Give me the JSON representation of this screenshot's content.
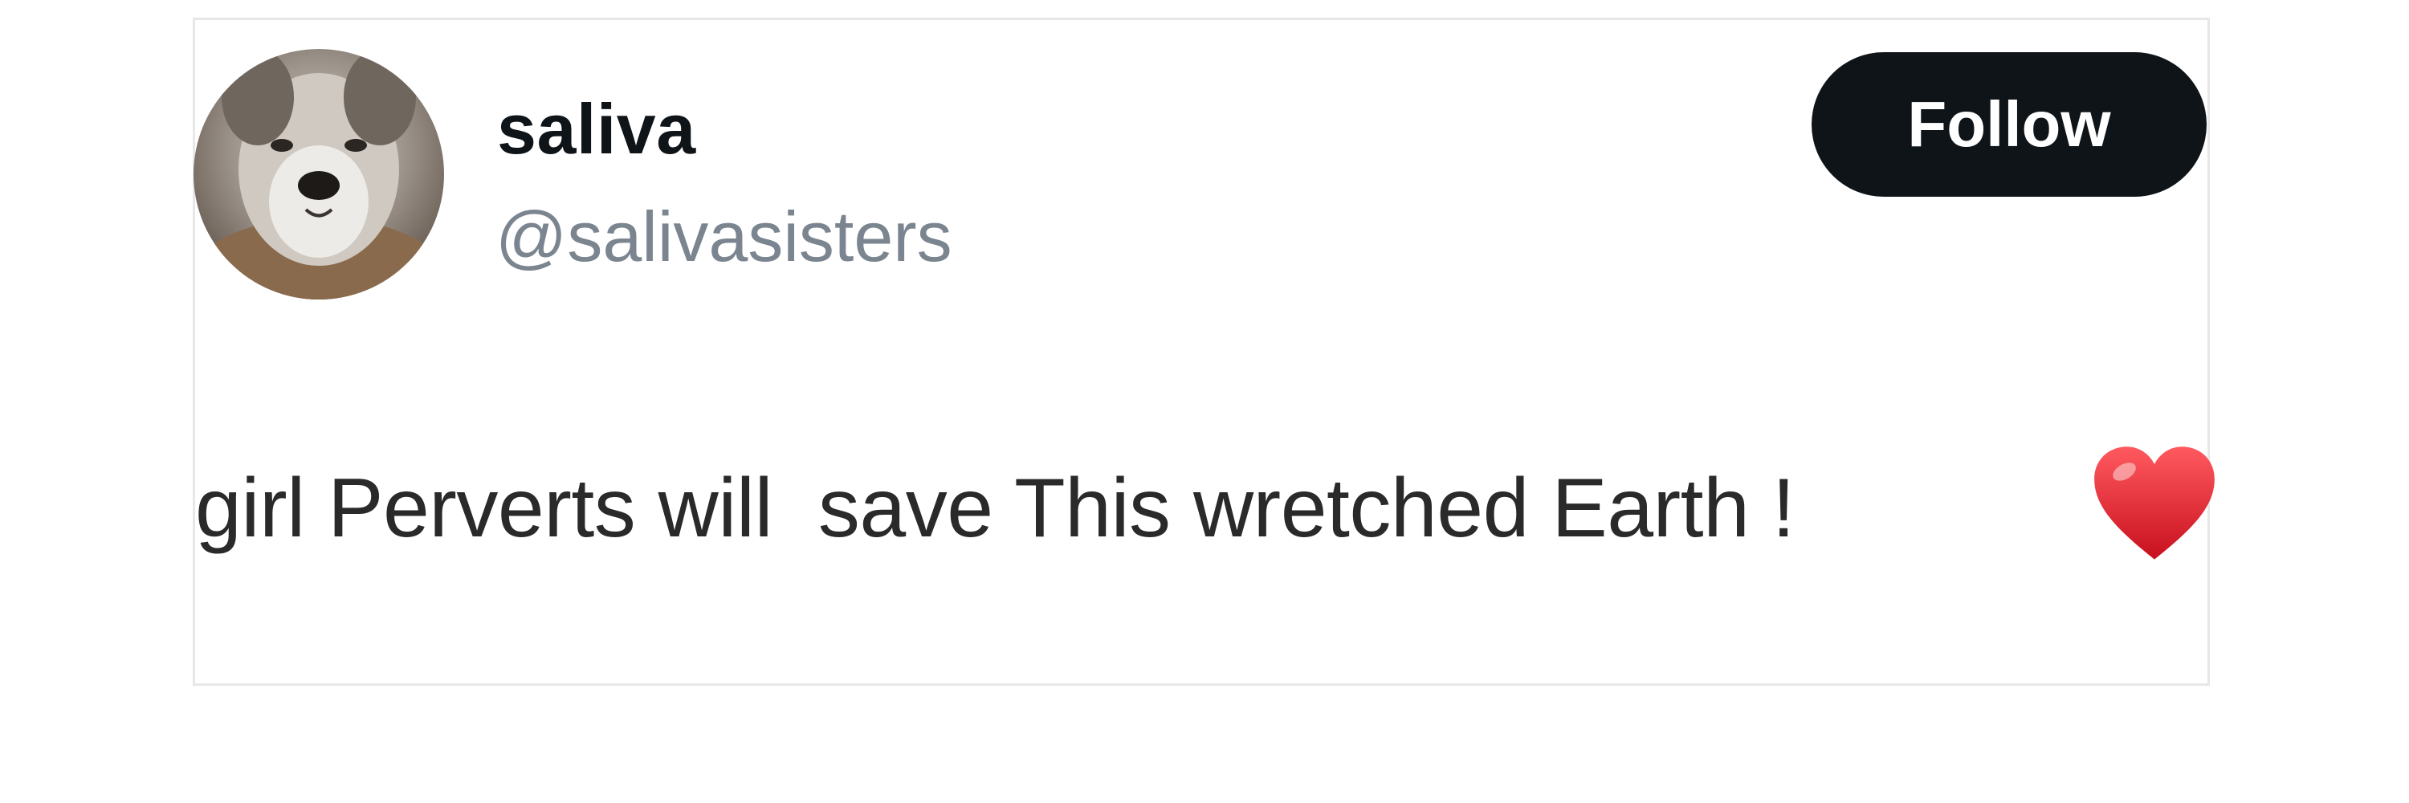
{
  "post": {
    "author": {
      "name": "saliva",
      "handle": "@salivasisters",
      "avatar_icon": "wolf-avatar-icon"
    },
    "follow_label": "Follow",
    "text": "girl Perverts will  save This wretched Earth !",
    "emoji_icon": "red-heart-icon"
  },
  "colors": {
    "follow_bg": "#0f1419",
    "handle": "#7b8590",
    "heart": "#e3192b"
  }
}
